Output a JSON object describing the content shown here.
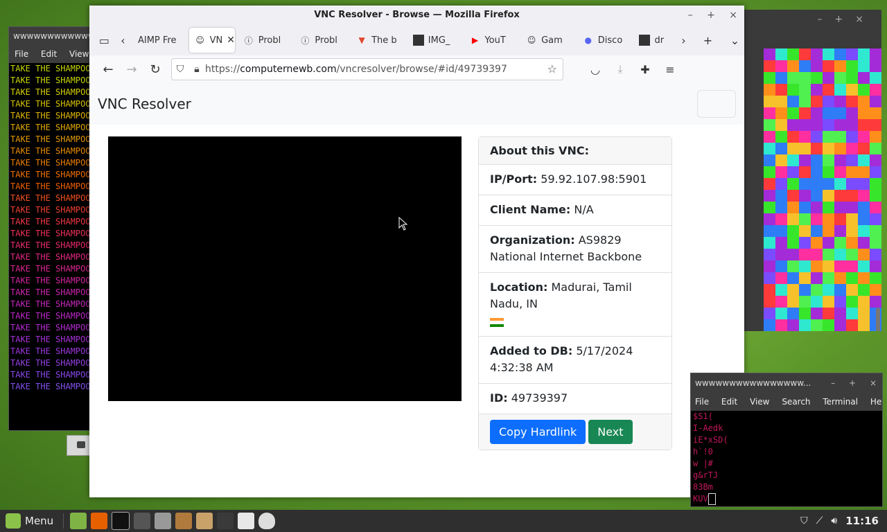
{
  "left_terminal": {
    "title": "wwwwwwwwwwwwwwww",
    "menu": [
      "File",
      "Edit",
      "View"
    ],
    "line_text": "TAKE THE SHAMPOO",
    "line_colors": [
      "#c8d800",
      "#c8d800",
      "#d6d000",
      "#d8c400",
      "#e0b800",
      "#e0a800",
      "#e69a00",
      "#e88c00",
      "#ec7e00",
      "#ee7000",
      "#f06000",
      "#f05020",
      "#f04030",
      "#f03844",
      "#ee3058",
      "#ea2a6c",
      "#e42880",
      "#dc2690",
      "#d424a0",
      "#cc24ae",
      "#c426bc",
      "#bc28c8",
      "#b42ad2",
      "#a830da",
      "#9e36e0",
      "#9440e6",
      "#8a48ea",
      "#8050ee"
    ]
  },
  "noise_window": {
    "controls": [
      "–",
      "+",
      "×"
    ],
    "palette": [
      "#2e7cf6",
      "#37e62a",
      "#ff3a3a",
      "#f6c12b",
      "#a42bd8",
      "#2ee8d0",
      "#ff8f1a",
      "#ff2fa0",
      "#7a4bff",
      "#4ff04f"
    ]
  },
  "firefox": {
    "title": "VNC Resolver - Browse — Mozilla Firefox",
    "window_controls": [
      "–",
      "+",
      "×"
    ],
    "tabs": [
      {
        "label": "AIMP Fre",
        "icon": "aimp"
      },
      {
        "label": "VN",
        "icon": "github",
        "active": true
      },
      {
        "label": "Probl",
        "icon": "info"
      },
      {
        "label": "Probl",
        "icon": "info"
      },
      {
        "label": "The b",
        "icon": "brave"
      },
      {
        "label": "IMG_",
        "icon": "image"
      },
      {
        "label": "YouT",
        "icon": "youtube"
      },
      {
        "label": "Gam",
        "icon": "github"
      },
      {
        "label": "Disco",
        "icon": "discord"
      },
      {
        "label": "dr",
        "icon": "image"
      }
    ],
    "url": {
      "prefix": "https://",
      "domain": "computernewb.com",
      "path": "/vncresolver/browse/#id/49739397"
    }
  },
  "page": {
    "brand": "VNC Resolver",
    "card": {
      "header": "About this VNC:",
      "rows": [
        {
          "label": "IP/Port:",
          "value": " 59.92.107.98:5901"
        },
        {
          "label": "Client Name:",
          "value": " N/A"
        },
        {
          "label": "Organization:",
          "value": " AS9829 National Internet Backbone"
        },
        {
          "label": "Location:",
          "value": " Madurai, Tamil Nadu, IN"
        },
        {
          "label": "Added to DB:",
          "value": " 5/17/2024 4:32:38 AM"
        },
        {
          "label": "ID:",
          "value": " 49739397"
        }
      ],
      "copy_button": "Copy Hardlink",
      "next_button": "Next"
    }
  },
  "right_terminal": {
    "title": "wwwwwwwwwwwwwwww...",
    "controls": [
      "–",
      "+",
      "×"
    ],
    "menu": [
      "File",
      "Edit",
      "View",
      "Search",
      "Terminal",
      "Help"
    ],
    "lines": [
      "$S1(",
      "I-Aedk",
      "iE*xSD(",
      "h`!0",
      "w |#",
      "g&rTJ",
      "83Bm",
      "KUV"
    ]
  },
  "taskbar": {
    "menu_label": "Menu",
    "clock": "11:16"
  }
}
